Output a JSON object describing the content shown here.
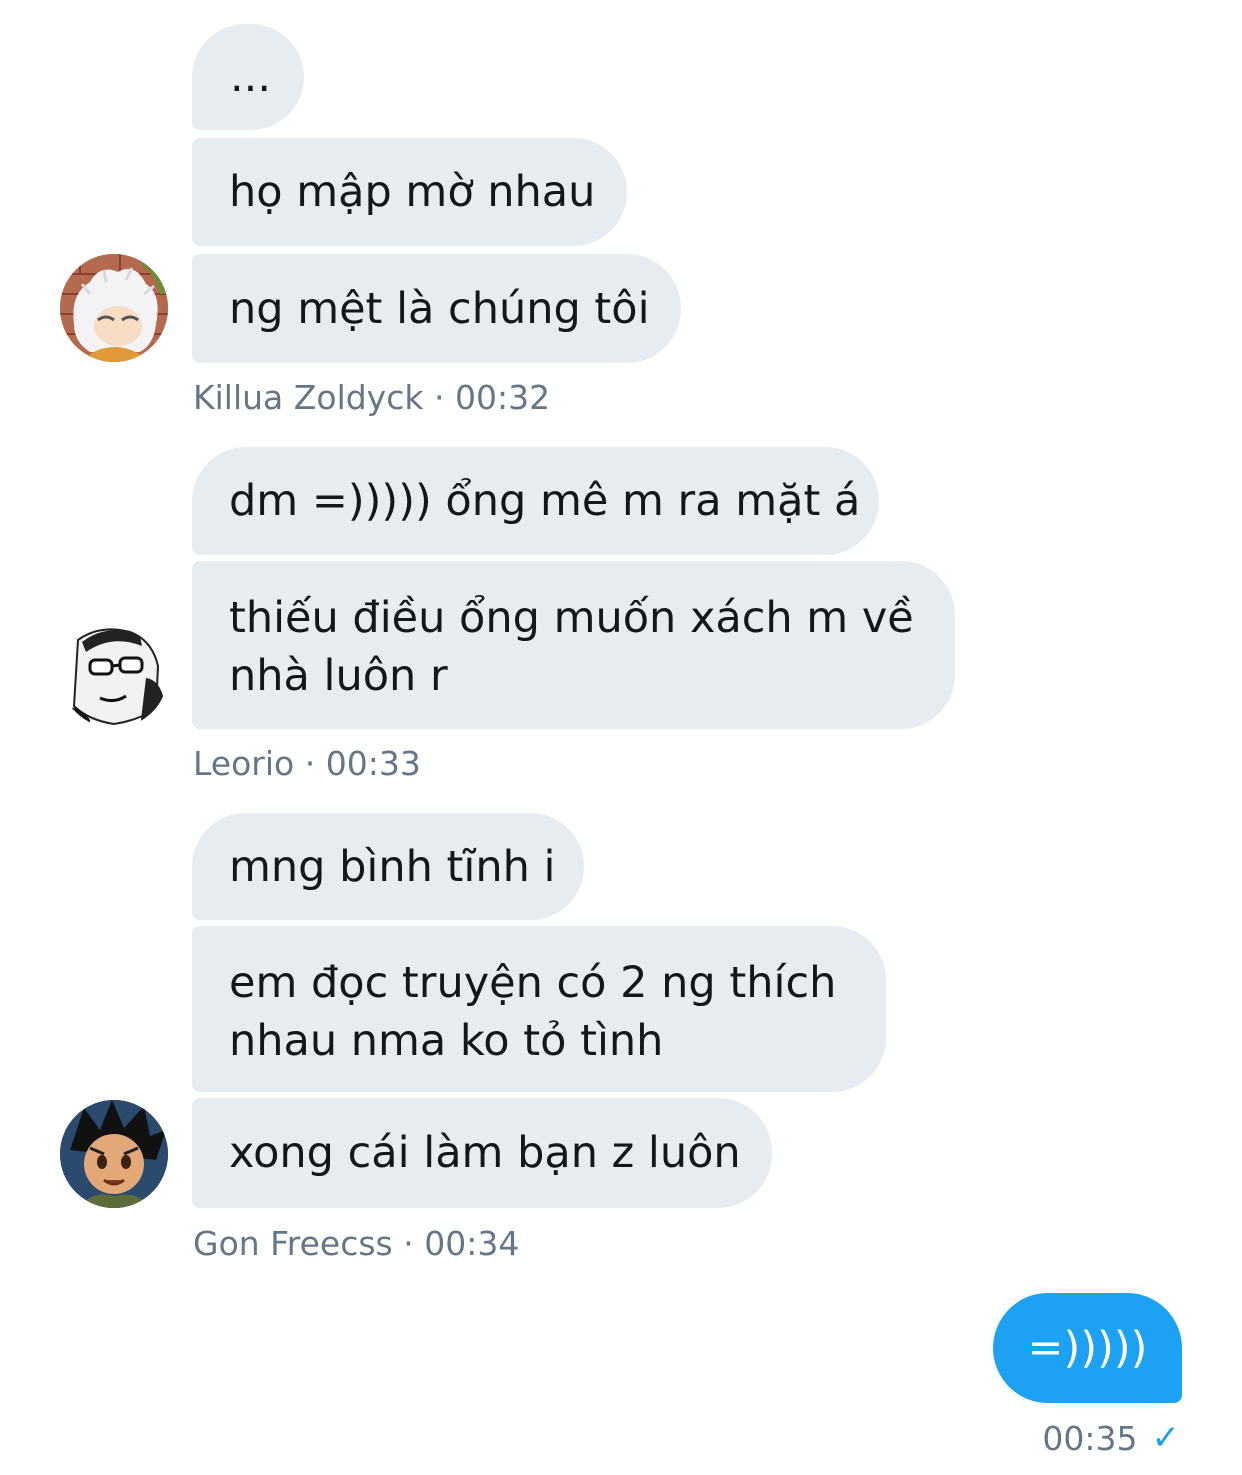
{
  "groups": [
    {
      "sender": "Killua Zoldyck",
      "time": "00:32",
      "avatar": "killua-avatar",
      "messages": [
        "...",
        "họ mập mờ nhau",
        "ng mệt là chúng tôi"
      ]
    },
    {
      "sender": "Leorio",
      "time": "00:33",
      "avatar": "leorio-avatar",
      "messages": [
        "dm =))))) ổng mê m ra mặt á",
        "thiếu điều ổng muốn xách m về nhà luôn r"
      ]
    },
    {
      "sender": "Gon Freecss",
      "time": "00:34",
      "avatar": "gon-avatar",
      "messages": [
        "mng bình tĩnh i",
        "em đọc truyện có 2 ng thích nhau nma ko tỏ tình",
        "xong cái làm bạn z luôn"
      ]
    }
  ],
  "outgoing": {
    "text": "=)))))",
    "time": "00:35",
    "status_icon": "check-icon"
  },
  "separator": "·",
  "colors": {
    "incoming_bubble": "#e6ecf0",
    "outgoing_bubble": "#1da1f2",
    "meta_text": "#657786"
  }
}
